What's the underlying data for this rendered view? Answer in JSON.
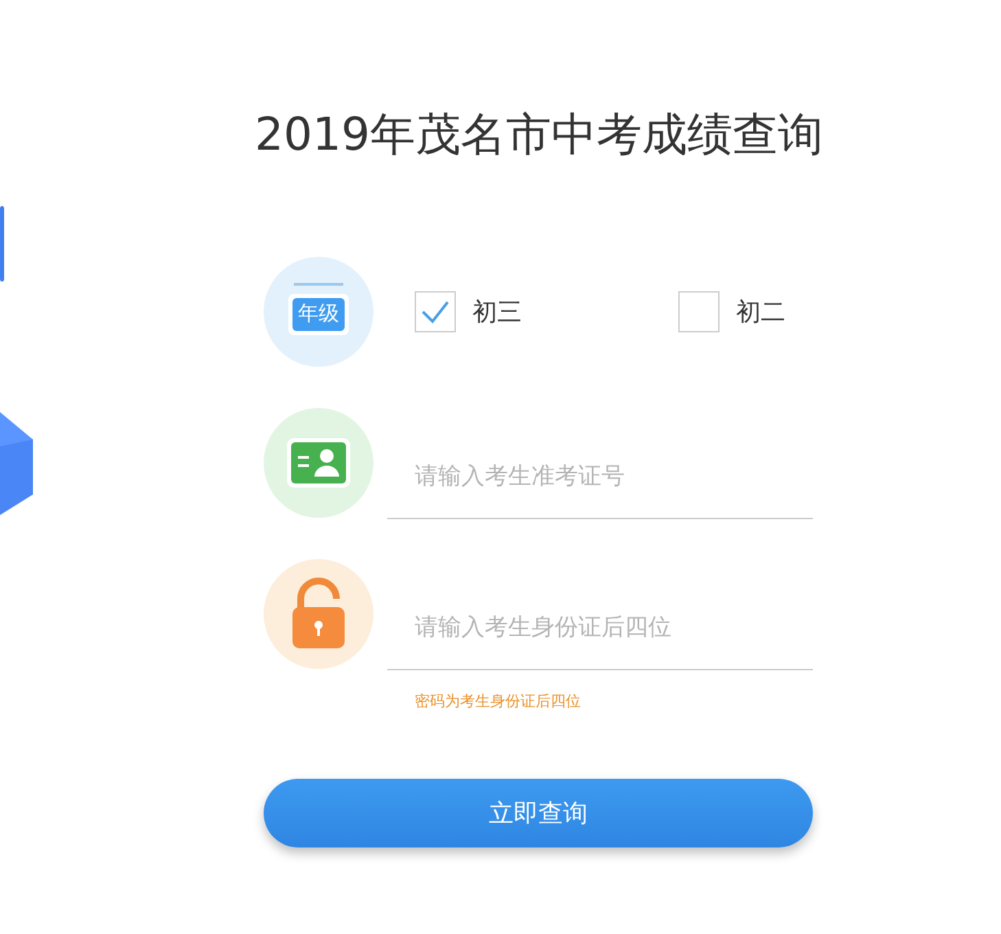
{
  "title": "2019年茂名市中考成绩查询",
  "grade": {
    "icon_label": "年级",
    "options": [
      {
        "label": "初三",
        "selected": true
      },
      {
        "label": "初二",
        "selected": false
      }
    ]
  },
  "fields": [
    {
      "kind": "id",
      "placeholder": "请输入考生准考证号"
    },
    {
      "kind": "lock",
      "placeholder": "请输入考生身份证后四位",
      "hint": "密码为考生身份证后四位"
    }
  ],
  "submit": "立即查询"
}
